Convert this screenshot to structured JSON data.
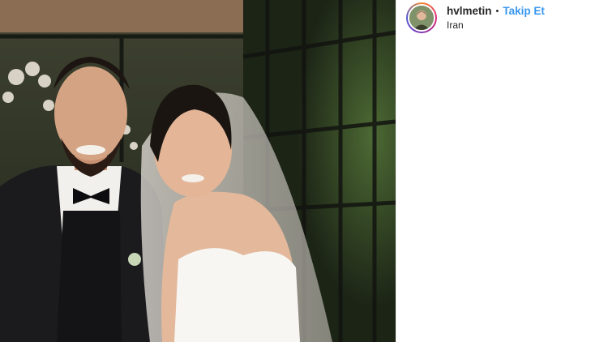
{
  "post": {
    "photo_alt": "wedding-photo",
    "header": {
      "username": "hvlmetin",
      "separator": "•",
      "follow_label": "Takip Et",
      "location": "Iran"
    }
  },
  "colors": {
    "follow": "#3897f0",
    "text": "#262626"
  },
  "icons": {
    "avatar": "profile-avatar"
  }
}
